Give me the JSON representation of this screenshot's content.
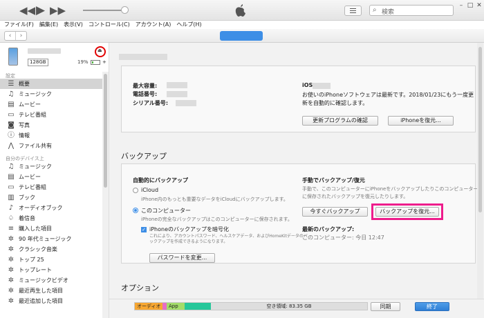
{
  "search": {
    "placeholder": "検索"
  },
  "menu": [
    "ファイル(F)",
    "編集(E)",
    "表示(V)",
    "コントロール(C)",
    "アカウント(A)",
    "ヘルプ(H)"
  ],
  "device": {
    "capacity": "128GB",
    "battery_percent": "19%",
    "battery_level": 0.19
  },
  "sidebar": {
    "settings_header": "設定",
    "settings_items": [
      {
        "label": "概要",
        "icon": "summary-icon",
        "glyph": "☰"
      },
      {
        "label": "ミュージック",
        "icon": "music-icon",
        "glyph": "♫"
      },
      {
        "label": "ムービー",
        "icon": "movie-icon",
        "glyph": "▤"
      },
      {
        "label": "テレビ番組",
        "icon": "tv-icon",
        "glyph": "▭"
      },
      {
        "label": "写真",
        "icon": "camera-icon",
        "glyph": "◙"
      },
      {
        "label": "情報",
        "icon": "info-icon",
        "glyph": "ⓘ"
      },
      {
        "label": "ファイル共有",
        "icon": "apps-icon",
        "glyph": "⋀"
      }
    ],
    "ondevice_header": "自分のデバイス上",
    "ondevice_items": [
      {
        "label": "ミュージック",
        "icon": "music-icon",
        "glyph": "♫"
      },
      {
        "label": "ムービー",
        "icon": "movie-icon",
        "glyph": "▤"
      },
      {
        "label": "テレビ番組",
        "icon": "tv-icon",
        "glyph": "▭"
      },
      {
        "label": "ブック",
        "icon": "book-icon",
        "glyph": "▥"
      },
      {
        "label": "オーディオブック",
        "icon": "audiobook-icon",
        "glyph": "♪"
      },
      {
        "label": "着信音",
        "icon": "bell-icon",
        "glyph": "♤"
      },
      {
        "label": "購入した項目",
        "icon": "playlist-icon",
        "glyph": "≡"
      },
      {
        "label": "90 年代ミュージック",
        "icon": "gear-icon",
        "glyph": "✲"
      },
      {
        "label": "クラシック音楽",
        "icon": "gear-icon",
        "glyph": "✲"
      },
      {
        "label": "トップ 25",
        "icon": "gear-icon",
        "glyph": "✲"
      },
      {
        "label": "トップレート",
        "icon": "gear-icon",
        "glyph": "✲"
      },
      {
        "label": "ミュージックビデオ",
        "icon": "gear-icon",
        "glyph": "✲"
      },
      {
        "label": "最近再生した項目",
        "icon": "gear-icon",
        "glyph": "✲"
      },
      {
        "label": "最近追加した項目",
        "icon": "gear-icon",
        "glyph": "✲"
      }
    ]
  },
  "info": {
    "capacity_label": "最大容量:",
    "phone_label": "電話番号:",
    "serial_label": "シリアル番号:",
    "ios_label": "iOS",
    "update_text_1": "お使いのiPhoneソフトウェアは最新です。2018/01/23にもう一度更",
    "update_text_2": "新を自動的に確認します。",
    "check_update_button": "更新プログラムの確認",
    "restore_iphone_button": "iPhoneを復元..."
  },
  "backup": {
    "title": "バックアップ",
    "auto_title": "自動的にバックアップ",
    "icloud_label": "iCloud",
    "icloud_desc": "iPhone内のもっとも重要なデータをiCloudにバックアップします。",
    "computer_label": "このコンピューター",
    "computer_desc": "iPhoneの完全なバックアップはこのコンピューターに保存されます。",
    "encrypt_label": "iPhoneのバックアップを暗号化",
    "encrypt_desc_1": "これにより、アカウントパスワード、ヘルスケアデータ、およびHomeKitデータのバ",
    "encrypt_desc_2": "ックアップを作成できるようになります。",
    "change_password_button": "パスワードを変更...",
    "manual_title": "手動でバックアップ/復元",
    "manual_desc_1": "手動で、このコンピューターにiPhoneをバックアップしたりこのコンピューター",
    "manual_desc_2": "に保存されたバックアップを復元したりします。",
    "backup_now_button": "今すぐバックアップ",
    "restore_backup_button": "バックアップを復元...",
    "latest_title": "最新のバックアップ:",
    "latest_value": "このコンピューター: 今日 12:47"
  },
  "options": {
    "title": "オプション"
  },
  "storage": {
    "audio_label": "オーディオ",
    "app_label": "App",
    "free_label": "空き領域: 83.35 GB",
    "colors": {
      "audio": "#f7a732",
      "photo": "#e76cc6",
      "app": "#a3dd6a",
      "other": "#26c79a",
      "free": "#dedede"
    }
  },
  "bottom": {
    "sync_button": "同期",
    "done_button": "終了"
  },
  "colors": {
    "accent": "#3d8ee6",
    "highlight": "#ee1c8c",
    "eject_circle": "#e20000"
  }
}
